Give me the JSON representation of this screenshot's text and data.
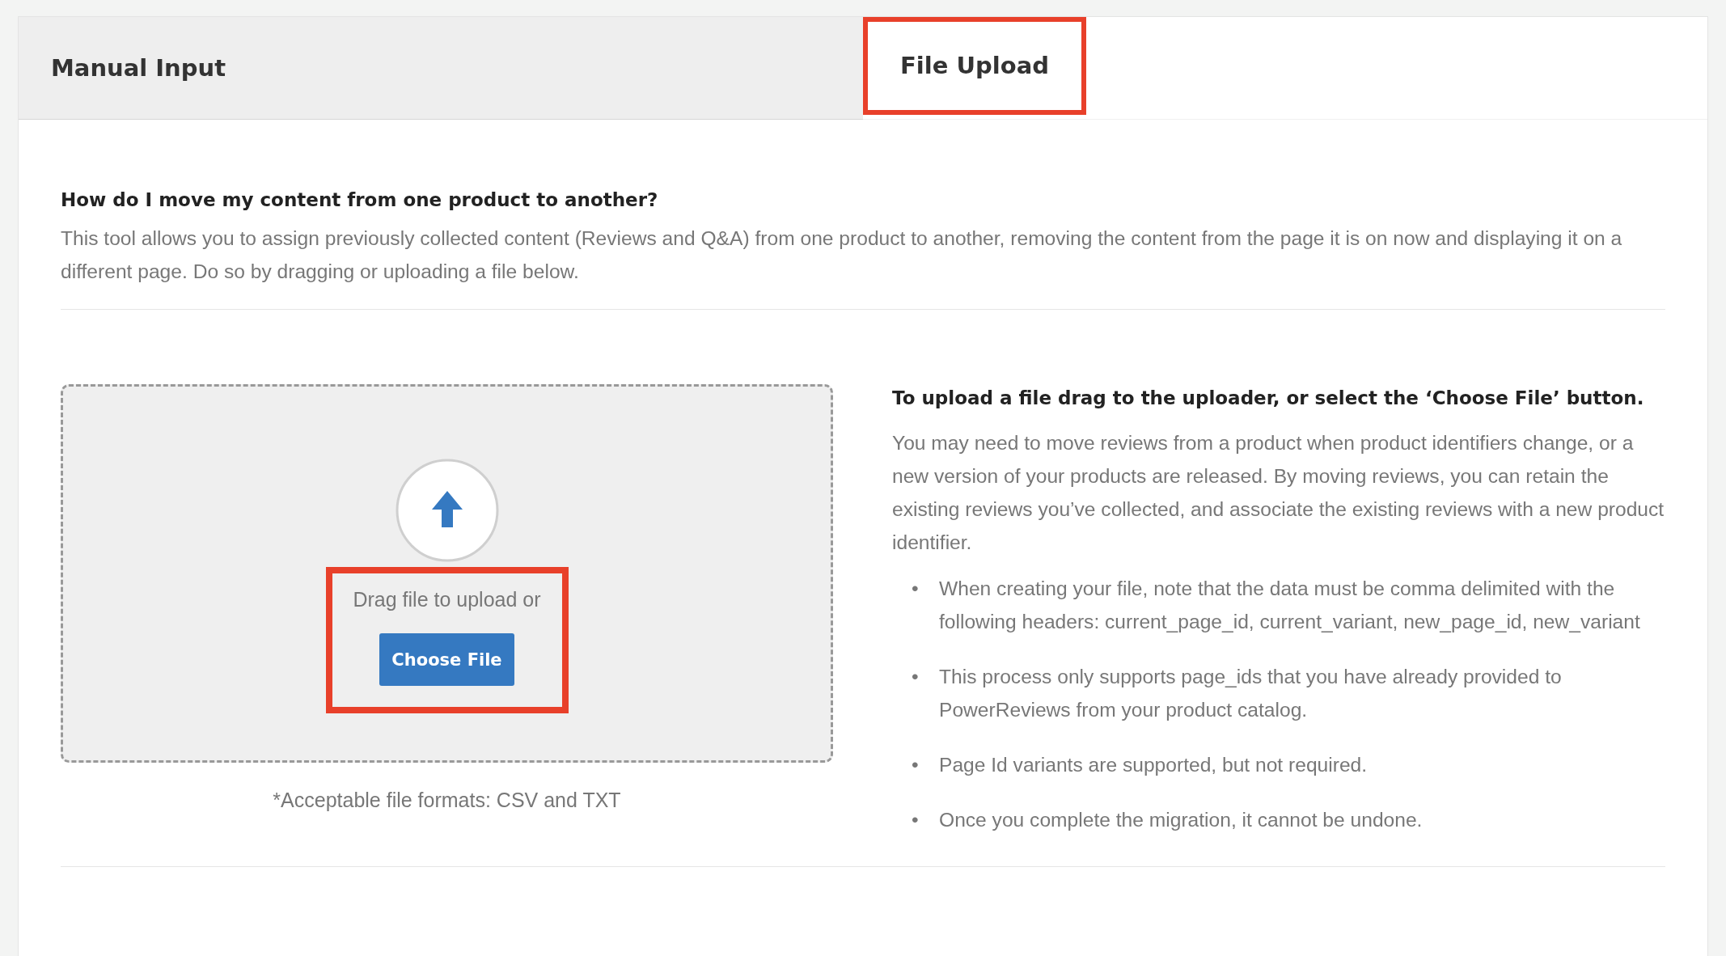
{
  "tabs": [
    {
      "label": "Manual Input",
      "selected": false,
      "highlighted": false
    },
    {
      "label": "File Upload",
      "selected": true,
      "highlighted": true
    }
  ],
  "intro": {
    "heading": "How do I move my content from one product to another?",
    "text": "This tool allows you to assign previously collected content (Reviews and Q&A) from one product to another, removing the content from the page it is on now and displaying it on a different page. Do so by dragging or uploading a file below."
  },
  "uploader": {
    "prompt": "Drag file to upload or",
    "button": "Choose File",
    "highlighted": true,
    "formats_note": "*Acceptable file formats: CSV and TXT"
  },
  "instructions": {
    "heading": "To upload a file drag to the uploader, or select the ‘Choose File’ button.",
    "text": "You may need to move reviews from a product when product identifiers change, or a new version of your products are released. By moving reviews, you can retain the existing reviews you’ve collected, and associate the existing reviews with a new product identifier.",
    "bullets": [
      {
        "marker": "•",
        "text": "When creating your file, note that the data must be comma delimited with the following headers: current_page_id, current_variant, new_page_id, new_variant"
      },
      {
        "marker": "•",
        "text": "This process only supports page_ids that you have already provided to PowerReviews from your product catalog."
      },
      {
        "marker": "•",
        "text": "Page Id variants are supported, but not required."
      },
      {
        "marker": "•",
        "text": "Once you complete the migration, it cannot be undone."
      }
    ]
  }
}
